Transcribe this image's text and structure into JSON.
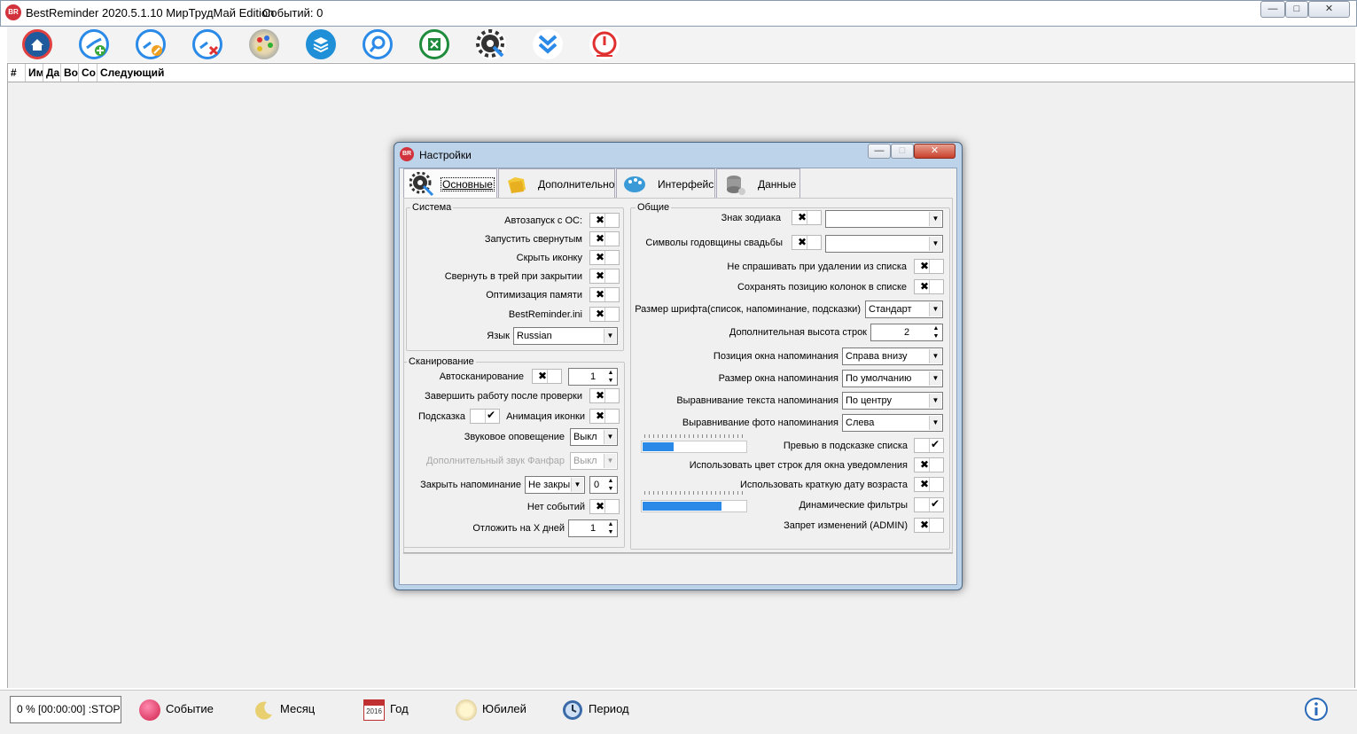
{
  "window": {
    "title": "BestReminder 2020.5.1.10 МирТрудМай Edition",
    "events_count": "Событий:  0",
    "app_icon": "BR",
    "minimize": "—",
    "maximize": "□",
    "close": "✕"
  },
  "toolbar_icons": [
    "home-icon",
    "add-event-icon",
    "edit-event-icon",
    "delete-event-icon",
    "palette-icon",
    "layers-icon",
    "search-icon",
    "excel-icon",
    "settings-icon",
    "collapse-icon",
    "power-icon"
  ],
  "columns": [
    "#",
    "Им",
    "Да",
    "Во",
    "Со",
    "Следующий"
  ],
  "status": {
    "text": "0 % [00:00:00] :STOP",
    "buttons": {
      "event": "Событие",
      "month": "Месяц",
      "year": "Год",
      "jubilee": "Юбилей",
      "period": "Период"
    }
  },
  "dialog": {
    "title": "Настройки",
    "app_icon": "BR",
    "tabs": [
      "Основные",
      "Дополнительно",
      "Интерфейс",
      "Данные"
    ],
    "system": {
      "title": "Система",
      "autostart": "Автозапуск с ОС:",
      "start_minimized": "Запустить свернутым",
      "hide_icon": "Скрыть иконку",
      "minimize_to_tray": "Свернуть в трей при закрытии",
      "memory_opt": "Оптимизация памяти",
      "ini": "BestReminder.ini",
      "lang_label": "Язык",
      "lang_value": "Russian"
    },
    "scan": {
      "title": "Сканирование",
      "autoscan": "Автосканирование",
      "autoscan_value": "1",
      "exit_after": "Завершить работу после проверки",
      "hint": "Подсказка",
      "icon_anim": "Анимация иконки",
      "sound": "Звуковое оповещение",
      "sound_value": "Выкл",
      "fanfare": "Дополнительный звук Фанфар",
      "fanfare_value": "Выкл",
      "close_reminder": "Закрыть напоминание",
      "close_value": "Не закры",
      "close_num": "0",
      "no_events": "Нет событий",
      "postpone": "Отложить на X дней",
      "postpone_value": "1"
    },
    "general": {
      "title": "Общие",
      "zodiac": "Знак зодиака",
      "wedding": "Символы годовщины свадьбы",
      "no_ask_delete": "Не спрашивать при удалении из списка",
      "save_columns": "Сохранять позицию колонок в списке",
      "font_size": "Размер шрифта(список, напоминание, подсказки)",
      "font_size_value": "Стандарт",
      "row_height": "Дополнительная высота строк",
      "row_height_value": "2",
      "window_pos": "Позиция окна напоминания",
      "window_pos_value": "Справа внизу",
      "window_size": "Размер окна напоминания",
      "window_size_value": "По умолчанию",
      "text_align": "Выравнивание текста напоминания",
      "text_align_value": "По центру",
      "photo_align": "Выравнивание фото напоминания",
      "photo_align_value": "Слева",
      "preview": "Превью в подсказке списка",
      "row_color": "Использовать цвет строк для окна уведомления",
      "short_date": "Использовать краткую дату возраста",
      "dyn_filters": "Динамические фильтры",
      "admin_lock": "Запрет изменений (ADMIN)",
      "slider1_level": 0.3,
      "slider2_level": 0.77
    },
    "marks": {
      "x": "✖",
      "check": "✔"
    }
  },
  "colors": {
    "accent": "#2b8ae8",
    "brand": "#d2323c"
  }
}
